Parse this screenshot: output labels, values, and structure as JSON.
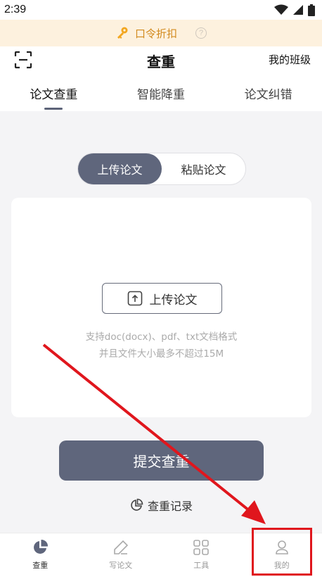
{
  "status_bar": {
    "time": "2:39"
  },
  "banner": {
    "text": "口令折扣",
    "help": "?"
  },
  "header": {
    "title": "查重",
    "my_class": "我的班级"
  },
  "tabs": [
    {
      "label": "论文查重",
      "active": true
    },
    {
      "label": "智能降重",
      "active": false
    },
    {
      "label": "论文纠错",
      "active": false
    }
  ],
  "segmented": {
    "upload": "上传论文",
    "paste": "粘贴论文",
    "selected": "上传论文"
  },
  "upload_card": {
    "button_label": "上传论文",
    "hint_line1": "支持doc(docx)、pdf、txt文档格式",
    "hint_line2": "并且文件大小最多不超过15M"
  },
  "submit": {
    "label": "提交查重"
  },
  "record_link": {
    "label": "查重记录"
  },
  "bottom_nav": [
    {
      "label": "查重",
      "icon": "pie-chart-icon",
      "active": true
    },
    {
      "label": "写论文",
      "icon": "pencil-icon",
      "active": false
    },
    {
      "label": "工具",
      "icon": "grid-icon",
      "active": false
    },
    {
      "label": "我的",
      "icon": "user-icon",
      "active": false
    }
  ],
  "colors": {
    "accent": "#5f667c",
    "banner_bg": "#fdf1de",
    "banner_text": "#d28a1e",
    "annotation": "#e0161d"
  }
}
